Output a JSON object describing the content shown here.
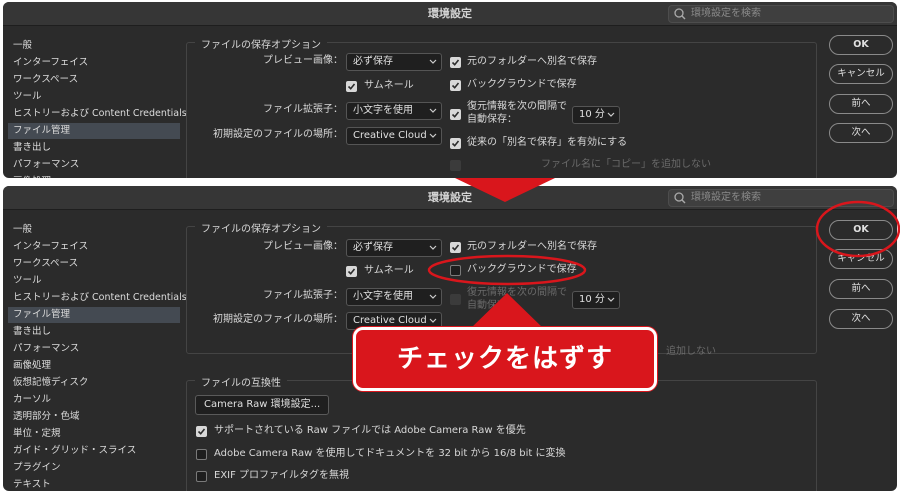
{
  "window_title": "環境設定",
  "search_placeholder": "環境設定を検索",
  "sidebar_top": [
    "一般",
    "インターフェイス",
    "ワークスペース",
    "ツール",
    "ヒストリーおよび Content Credentials",
    "ファイル管理",
    "書き出し",
    "パフォーマンス",
    "画像処理"
  ],
  "sidebar_bottom": [
    "一般",
    "インターフェイス",
    "ワークスペース",
    "ツール",
    "ヒストリーおよび Content Credentials",
    "ファイル管理",
    "書き出し",
    "パフォーマンス",
    "画像処理",
    "仮想記憶ディスク",
    "カーソル",
    "透明部分・色域",
    "単位・定規",
    "ガイド・グリッド・スライス",
    "プラグイン",
    "テキスト"
  ],
  "save_options": {
    "legend": "ファイルの保存オプション",
    "preview_label": "プレビュー画像：",
    "preview_value": "必ず保存",
    "thumbnail": "サムネール",
    "ext_label": "ファイル拡張子：",
    "ext_value": "小文字を使用",
    "location_label": "初期設定のファイルの場所：",
    "location_value": "Creative Cloud",
    "save_as_original": "元のフォルダーへ別名で保存",
    "background_save": "バックグラウンドで保存",
    "autosave_line1": "復元情報を次の間隔で",
    "autosave_line2": "自動保存：",
    "autosave_value": "10 分",
    "legacy_save_as": "従来の「別名で保存」を有効にする",
    "no_copy": "ファイル名に「コピー」を追加しない"
  },
  "bottom_visible": {
    "autosave_line1": "復元情報を次の間隔で",
    "autosave_line2": "自動保存",
    "no_copy_tail": "追加しない"
  },
  "compat": {
    "legend": "ファイルの互換性",
    "camera_raw_button": "Camera Raw 環境設定...",
    "opt1": "サポートされている Raw ファイルでは Adobe Camera Raw を優先",
    "opt2": "Adobe Camera Raw を使用してドキュメントを 32 bit から 16/8 bit に変換",
    "opt3": "EXIF プロファイルタグを無視"
  },
  "buttons": {
    "ok": "OK",
    "cancel": "キャンセル",
    "prev": "前へ",
    "next": "次へ"
  },
  "callout": "チェックをはずす",
  "colors": {
    "accent_red": "#d9161c",
    "panel_bg": "#2b2b2b",
    "selected_bg": "#444a52"
  }
}
